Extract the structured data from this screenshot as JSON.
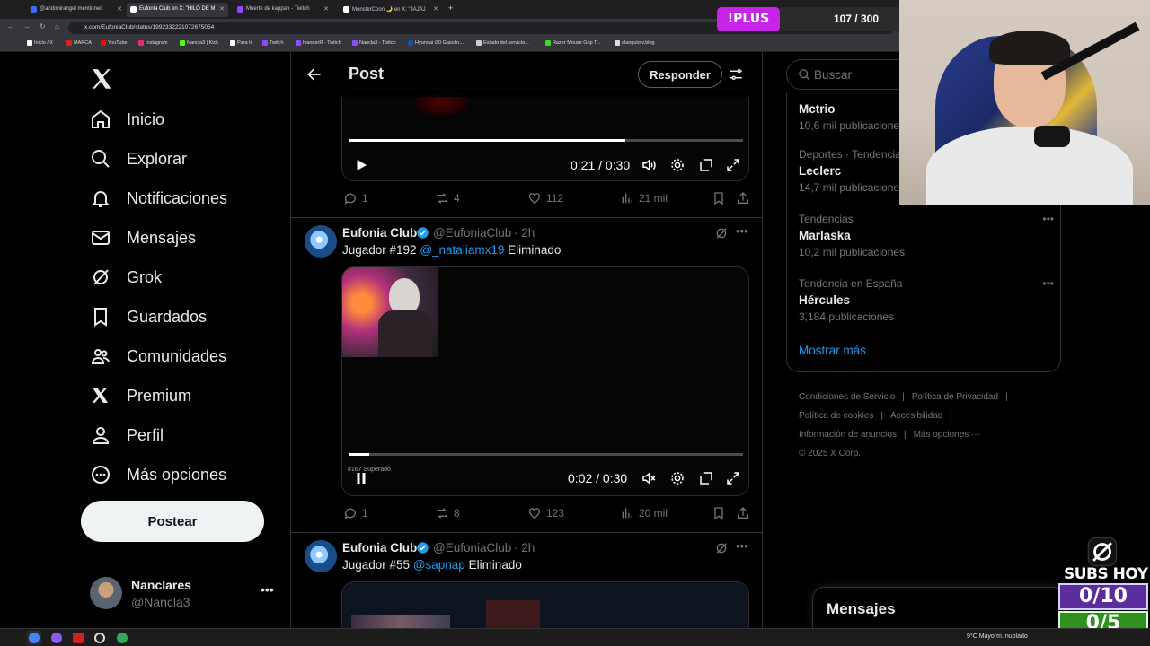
{
  "browser": {
    "tabs": [
      {
        "label": "@andonirangel mentioned",
        "color": "#3b6ef5"
      },
      {
        "label": "Eufonia Club en X: \"HILO DE M",
        "color": "#ffffff"
      },
      {
        "label": "Muerte de kappah - Twitch",
        "color": "#9146ff"
      },
      {
        "label": "MonsterCoon 🌙 en X: \"JAJAJ",
        "color": "#ffffff"
      }
    ],
    "url": "x.com/EufoniaClub/status/1992332221072675054",
    "bookmarks": [
      {
        "label": "Inicio / X",
        "color": "#ffffff"
      },
      {
        "label": "MARCA",
        "color": "#e02020"
      },
      {
        "label": "YouTube",
        "color": "#ff0000"
      },
      {
        "label": "Instagram",
        "color": "#e1306c"
      },
      {
        "label": "Nancla3 | Kick",
        "color": "#53fc18"
      },
      {
        "label": "Para ti",
        "color": "#ffffff"
      },
      {
        "label": "Twitch",
        "color": "#9146ff"
      },
      {
        "label": "IvanderR - Twitch",
        "color": "#9146ff"
      },
      {
        "label": "Nancla3 - Twitch",
        "color": "#9146ff"
      },
      {
        "label": "Hyundai i30 Gasolin...",
        "color": "#1c4f9c"
      },
      {
        "label": "Estado del servicio...",
        "color": "#cccccc"
      },
      {
        "label": "Razer Mouse Grip T...",
        "color": "#44d62c"
      },
      {
        "label": "alanguiotv.blog",
        "color": "#dddddd"
      }
    ]
  },
  "nav": {
    "items": [
      {
        "label": "Inicio",
        "icon": "home-icon"
      },
      {
        "label": "Explorar",
        "icon": "search-icon"
      },
      {
        "label": "Notificaciones",
        "icon": "bell-icon"
      },
      {
        "label": "Mensajes",
        "icon": "mail-icon"
      },
      {
        "label": "Grok",
        "icon": "grok-icon"
      },
      {
        "label": "Guardados",
        "icon": "bookmark-icon"
      },
      {
        "label": "Comunidades",
        "icon": "communities-icon"
      },
      {
        "label": "Premium",
        "icon": "x-premium-icon"
      },
      {
        "label": "Perfil",
        "icon": "person-icon"
      },
      {
        "label": "Más opciones",
        "icon": "more-circle-icon"
      }
    ],
    "post_label": "Postear",
    "profile": {
      "name": "Nanclares",
      "handle": "@Nancla3"
    }
  },
  "header": {
    "title": "Post",
    "reply_label": "Responder"
  },
  "tweets": [
    {
      "video": {
        "time": "0:21 / 0:30",
        "progress": 0.7,
        "state": "paused"
      },
      "stats": {
        "replies": "1",
        "reposts": "4",
        "likes": "112",
        "views": "21 mil"
      }
    },
    {
      "author": "Eufonia Club",
      "handle": "@EufoniaClub",
      "time": "· 2h",
      "text_prefix": "Jugador #192 ",
      "mention": "@_nataliamx19",
      "text_suffix": " Eliminado",
      "video": {
        "time": "0:02 / 0:30",
        "progress": 0.05,
        "state": "playing",
        "caption": "#167 Superado"
      },
      "stats": {
        "replies": "1",
        "reposts": "8",
        "likes": "123",
        "views": "20 mil"
      }
    },
    {
      "author": "Eufonia Club",
      "handle": "@EufoniaClub",
      "time": "· 2h",
      "text_prefix": "Jugador #55 ",
      "mention": "@sapnap",
      "text_suffix": " Eliminado"
    }
  ],
  "right": {
    "search_placeholder": "Buscar",
    "trends": [
      {
        "context": "",
        "title": "Mctrio",
        "count": "10,6 mil publicaciones"
      },
      {
        "context": "Deportes · Tendencia",
        "title": "Leclerc",
        "count": "14,7 mil publicaciones"
      },
      {
        "context": "Tendencias",
        "title": "Marlaska",
        "count": "10,2 mil publicaciones"
      },
      {
        "context": "Tendencia en España",
        "title": "Hércules",
        "count": "3,184 publicaciones"
      }
    ],
    "show_more": "Mostrar más",
    "footer": {
      "terms": "Condiciones de Servicio",
      "privacy": "Política de Privacidad",
      "cookies": "Política de cookies",
      "accessibility": "Accesibilidad",
      "ads": "Información de anuncios",
      "more": "Más opciones ···",
      "copyright": "© 2025 X Corp."
    },
    "messages_label": "Mensajes"
  },
  "overlay": {
    "plus_label": "!PLUS",
    "counter": "107 / 300",
    "subs_title": "SUBS HOY",
    "subs_a": "0/10",
    "subs_b": "0/5"
  },
  "taskbar": {
    "weather": "9°C  Mayorm. nublado"
  },
  "colors": {
    "accent": "#1d9bf0",
    "text": "#e7e9ea",
    "muted": "#71767b",
    "plus": "#c724e8"
  }
}
